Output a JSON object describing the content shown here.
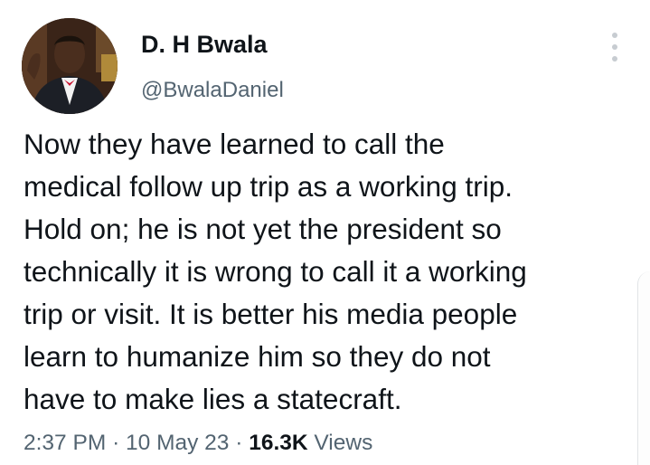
{
  "author": {
    "display_name": "D. H Bwala",
    "handle": "@BwalaDaniel",
    "avatar_icon": "profile-photo-icon"
  },
  "tweet": {
    "text_lines": [
      "Now they have learned to call the",
      "medical follow up trip as a working trip.",
      "Hold on; he is not yet the president so",
      "technically it is wrong to call it a working",
      "trip or visit. It is better his media people",
      "learn to humanize him so they do not",
      "have to make lies a statecraft."
    ]
  },
  "meta": {
    "time": "2:37 PM",
    "separator": "·",
    "date": "10 May 23",
    "views_count": "16.3K",
    "views_label": "Views"
  },
  "menu_icon": "more-options-icon",
  "colors": {
    "text_primary": "#0f1419",
    "text_secondary": "#536471",
    "background": "#ffffff"
  }
}
